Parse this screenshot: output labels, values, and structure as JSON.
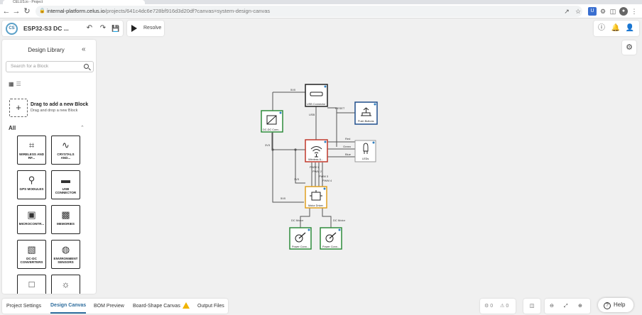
{
  "browser": {
    "tab_title": "CELUS.io - Project",
    "url_host": "internal-platform.celus.io",
    "url_path": "/projects/641c4dc6e728bf916d3d20df?canvas=system-design-canvas"
  },
  "header": {
    "logo_text": "CS",
    "project_name": "ESP32-S3 DC ...",
    "resolve_label": "Resolve"
  },
  "library": {
    "title": "Design Library",
    "search_placeholder": "Search for a Block",
    "drag_title": "Drag to add a new Block",
    "drag_sub": "Drag and drop a new Block",
    "section_label": "All",
    "blocks": [
      {
        "label": "WIRELESS AND RF...",
        "icon": "wireless-icon"
      },
      {
        "label": "CRYSTALS AND...",
        "icon": "crystal-icon"
      },
      {
        "label": "GPS MODULES",
        "icon": "gps-icon"
      },
      {
        "label": "USB CONNECTOR",
        "icon": "usb-icon"
      },
      {
        "label": "MICROCONTR...",
        "icon": "chip-icon"
      },
      {
        "label": "MEMORIES",
        "icon": "memory-icon"
      },
      {
        "label": "DC-DC CONVERTERS",
        "icon": "dcdc-icon"
      },
      {
        "label": "ENVIRONMENT SENSORS",
        "icon": "sensor-icon"
      }
    ]
  },
  "canvas": {
    "nodes": {
      "usb": {
        "label": "USB Connector",
        "color": "#222222"
      },
      "dcdc": {
        "label": "DC-DC Conv...",
        "color": "#2e8b3a"
      },
      "buttons": {
        "label": "Push Buttons",
        "color": "#1f4e8c"
      },
      "wireless": {
        "label": "Wireless &...",
        "color": "#c0392b"
      },
      "leds": {
        "label": "LEDs",
        "color": "#999999"
      },
      "motor": {
        "label": "Motor Driver",
        "color": "#e0a020"
      },
      "conn1": {
        "label": "Power Conn...",
        "color": "#2e8b3a"
      },
      "conn2": {
        "label": "Power Conn...",
        "color": "#2e8b3a"
      }
    },
    "wire_labels": {
      "v5_top": "5V0",
      "usb": "USB",
      "reset": "RESET",
      "v3_left": "3V3",
      "red": "Red",
      "green": "Green",
      "blue": "Blue",
      "pwm1": "PWM 1",
      "pwm2": "PWM 2",
      "pwm3": "PWM 3",
      "pwm4": "PWM 4",
      "v3_mid": "3V3",
      "v5_bottom": "5V0",
      "dc_motor_1": "DC Motor",
      "dc_motor_2": "DC Motor"
    }
  },
  "bottom": {
    "tabs": [
      "Project Settings",
      "Design Canvas",
      "BOM Preview",
      "Board-Shape Canvas",
      "Output Files"
    ],
    "active_tab": "Design Canvas",
    "error_count": "0",
    "warning_count": "0",
    "help_label": "Help"
  }
}
